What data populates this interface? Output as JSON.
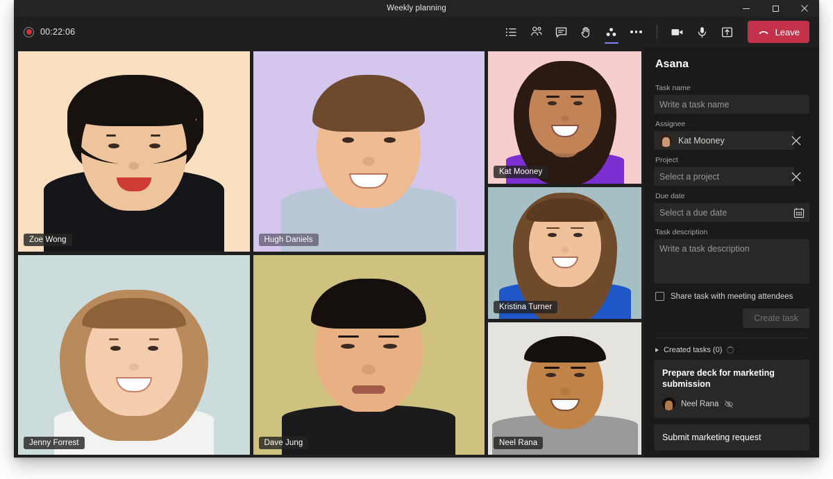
{
  "window": {
    "title": "Weekly planning",
    "minimize_label": "Minimize",
    "maximize_label": "Maximize",
    "close_label": "Close"
  },
  "toolbar": {
    "recording_time": "00:22:06",
    "icons": [
      {
        "name": "agenda-icon",
        "label": "Meeting notes"
      },
      {
        "name": "people-icon",
        "label": "Show participants"
      },
      {
        "name": "chat-icon",
        "label": "Show conversation"
      },
      {
        "name": "raise-hand-icon",
        "label": "Raise hand"
      },
      {
        "name": "apps-icon",
        "label": "Apps",
        "active": true
      },
      {
        "name": "more-options-icon",
        "label": "More actions"
      },
      {
        "name": "camera-icon",
        "label": "Camera"
      },
      {
        "name": "microphone-icon",
        "label": "Mic"
      },
      {
        "name": "share-screen-icon",
        "label": "Share content"
      }
    ],
    "leave_label": "Leave"
  },
  "stage": {
    "participants": [
      {
        "name": "Zoe Wong",
        "bg": "#fae0c0",
        "tag_style": "dark"
      },
      {
        "name": "Hugh Daniels",
        "bg": "#d4c6ec",
        "tag_style": "light"
      },
      {
        "name": "Jenny Forrest",
        "bg": "#ccdcdc",
        "tag_style": "dark"
      },
      {
        "name": "Dave Jung",
        "bg": "#cfc281",
        "tag_style": "dark"
      },
      {
        "name": "Kat Mooney",
        "bg": "#f7cdcd",
        "tag_style": "dark"
      },
      {
        "name": "Kristina Turner",
        "bg": "#a5bfc4",
        "tag_style": "dark"
      },
      {
        "name": "Neel Rana",
        "bg": "#e5e3de",
        "tag_style": "dark"
      }
    ]
  },
  "panel": {
    "title": "Asana",
    "task_name": {
      "label": "Task name",
      "value": "",
      "placeholder": "Write a task name"
    },
    "assignee": {
      "label": "Assignee",
      "value": "Kat Mooney",
      "clear_label": "Clear assignee"
    },
    "project": {
      "label": "Project",
      "value": "",
      "placeholder": "Select a project",
      "clear_label": "Clear project"
    },
    "due_date": {
      "label": "Due date",
      "value": "",
      "placeholder": "Select a due date",
      "picker_label": "Open calendar"
    },
    "description": {
      "label": "Task description",
      "value": "",
      "placeholder": "Write a task description"
    },
    "share_checkbox": {
      "label": "Share task with meeting attendees",
      "checked": false
    },
    "create_button": "Create task",
    "created_tasks": {
      "header": "Created tasks (0)",
      "items": [
        {
          "title": "Prepare deck for marketing submission",
          "assignee": "Neel Rana",
          "visibility_icon": "eye-off-icon"
        },
        {
          "title": "Submit marketing request",
          "assignee": "",
          "visibility_icon": ""
        }
      ]
    }
  },
  "colors": {
    "accent": "#7f85f5",
    "leave_red": "#c4314b",
    "record_red": "#d13438",
    "panel_bg": "#1b1a19",
    "app_bg": "#1f1f1f"
  }
}
